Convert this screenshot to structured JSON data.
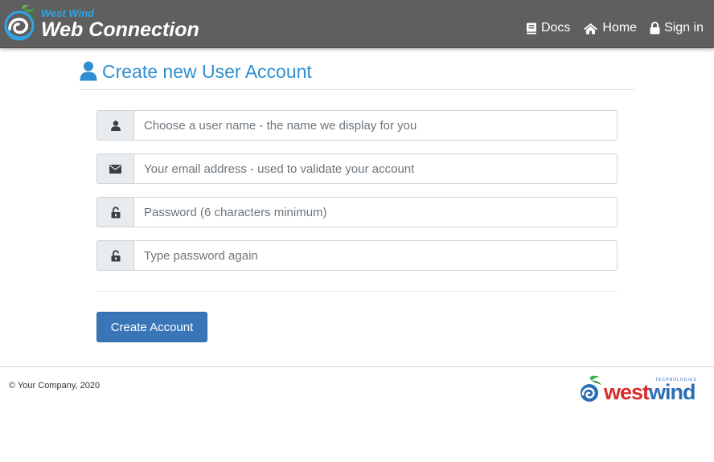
{
  "header": {
    "brand_small": "West Wind",
    "brand_big": "Web Connection",
    "nav": [
      {
        "label": "Docs",
        "icon": "book-icon"
      },
      {
        "label": "Home",
        "icon": "home-icon"
      },
      {
        "label": "Sign in",
        "icon": "lock-icon"
      }
    ]
  },
  "page": {
    "title": "Create new User Account",
    "title_icon": "user-icon"
  },
  "form": {
    "username_placeholder": "Choose a user name - the name we display for you",
    "email_placeholder": "Your email address - used to validate your account",
    "password_placeholder": "Password (6 characters minimum)",
    "password2_placeholder": "Type password again",
    "submit_label": "Create Account"
  },
  "footer": {
    "copyright": "© Your Company, 2020",
    "logo_west": "west",
    "logo_wind": "wind",
    "logo_tech": "TECHNOLOGIES"
  },
  "colors": {
    "topbar": "#5f5f5f",
    "accent": "#2f8fd0",
    "button": "#3876b8",
    "logo_red": "#d62d2d",
    "logo_blue": "#2a6db5"
  }
}
